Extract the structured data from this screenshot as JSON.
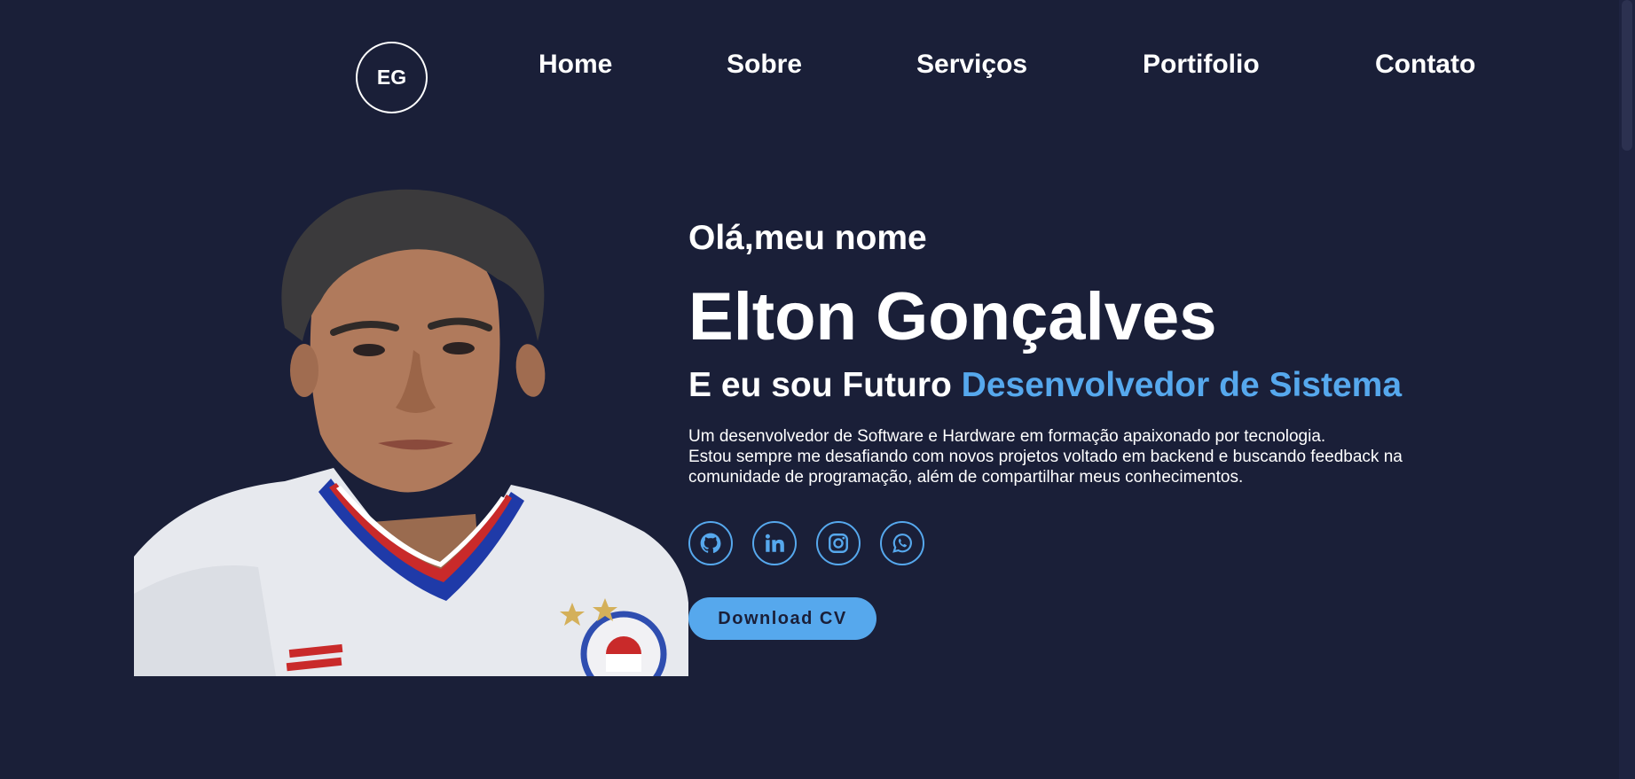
{
  "header": {
    "logo": "EG",
    "nav": [
      "Home",
      "Sobre",
      "Serviços",
      "Portifolio",
      "Contato"
    ]
  },
  "hero": {
    "greeting": "Olá,meu nome",
    "name": "Elton Gonçalves",
    "subtitle_prefix": "E eu sou Futuro ",
    "subtitle_highlight": "Desenvolvedor de Sistema",
    "bio_lines": [
      "Um desenvolvedor de Software e Hardware em formação apaixonado por tecnologia.",
      "Estou sempre me desafiando com novos projetos voltado em backend e buscando feedback na",
      "comunidade de programação, além de compartilhar meus conhecimentos."
    ],
    "socials": [
      "github-icon",
      "linkedin-icon",
      "instagram-icon",
      "whatsapp-icon"
    ],
    "cta_label": "Download CV"
  },
  "colors": {
    "background": "#1a1f38",
    "accent": "#56a8ed",
    "text": "#ffffff"
  }
}
